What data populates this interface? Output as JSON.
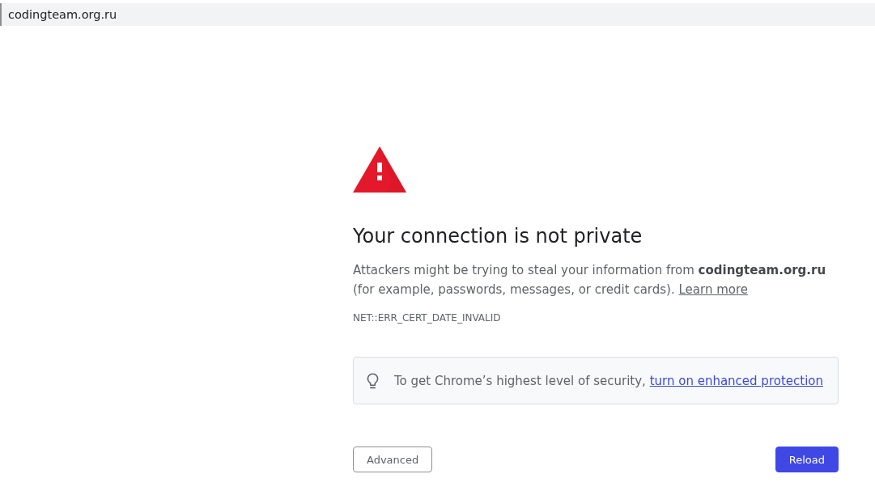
{
  "address_bar": {
    "url": "codingteam.org.ru"
  },
  "interstitial": {
    "title": "Your connection is not private",
    "message": "Attackers might be trying to steal your information from **codingteam.org.ru** (for example, passwords, messages, or credit cards).",
    "learn_more_link": "Learn more",
    "error_code": "NET::ERR_CERT_DATE_INVALID",
    "tip": {
      "text": "To get Chrome’s highest level of security,",
      "link": "turn on enhanced protection"
    },
    "buttons": [
      {
        "label": "Advanced",
        "kind": "secondary"
      },
      {
        "label": "Reload",
        "kind": "primary"
      }
    ]
  }
}
